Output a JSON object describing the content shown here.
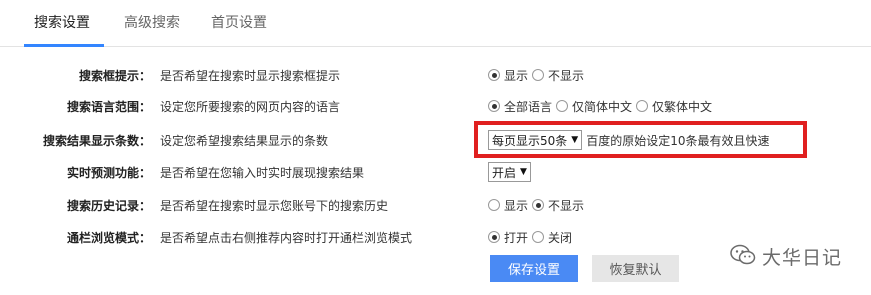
{
  "tabs": [
    {
      "label": "搜索设置",
      "active": true
    },
    {
      "label": "高级搜索",
      "active": false
    },
    {
      "label": "首页设置",
      "active": false
    }
  ],
  "settings": [
    {
      "label": "搜索框提示：",
      "desc": "是否希望在搜索时显示搜索框提示",
      "options": [
        {
          "text": "显示",
          "checked": true
        },
        {
          "text": "不显示",
          "checked": false
        }
      ]
    },
    {
      "label": "搜索语言范围：",
      "desc": "设定您所要搜索的网页内容的语言",
      "options": [
        {
          "text": "全部语言",
          "checked": true
        },
        {
          "text": "仅简体中文",
          "checked": false
        },
        {
          "text": "仅繁体中文",
          "checked": false
        }
      ]
    },
    {
      "label": "搜索结果显示条数：",
      "desc": "设定您希望搜索结果显示的条数",
      "select": "每页显示50条",
      "hint": "百度的原始设定10条最有效且快速"
    },
    {
      "label": "实时预测功能：",
      "desc": "是否希望在您输入时实时展现搜索结果",
      "select": "开启"
    },
    {
      "label": "搜索历史记录：",
      "desc": "是否希望在搜索时显示您账号下的搜索历史",
      "options": [
        {
          "text": "显示",
          "checked": false
        },
        {
          "text": "不显示",
          "checked": true
        }
      ]
    },
    {
      "label": "通栏浏览模式：",
      "desc": "是否希望点击右侧推荐内容时打开通栏浏览模式",
      "options": [
        {
          "text": "打开",
          "checked": true
        },
        {
          "text": "关闭",
          "checked": false
        }
      ]
    }
  ],
  "buttons": {
    "save": "保存设置",
    "reset": "恢复默认"
  },
  "watermark": {
    "text": "大华日记",
    "icon": "wechat-icon"
  },
  "colors": {
    "accent": "#3385ff",
    "save_bg": "#4a8af4",
    "highlight": "#e02020"
  }
}
